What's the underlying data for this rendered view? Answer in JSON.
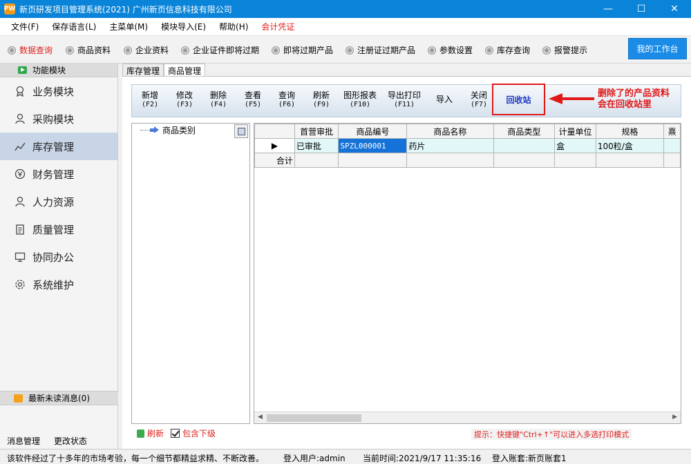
{
  "window": {
    "title": "新页研发项目管理系统(2021) 广州新页信息科技有限公司",
    "icon_text": "PW",
    "controls": [
      "—",
      "☐",
      "✕"
    ]
  },
  "menu": [
    "文件(F)",
    "保存语言(L)",
    "主菜单(M)",
    "模块导入(E)",
    "帮助(H)",
    "会计凭证"
  ],
  "quickbar": {
    "items": [
      "数据查询",
      "商品资料",
      "企业资料",
      "企业证件即将过期",
      "即将过期产品",
      "注册证过期产品",
      "参数设置",
      "库存查询",
      "报警提示"
    ],
    "workbench": "我的工作台"
  },
  "sidebar": {
    "header": "功能模块",
    "items": [
      "业务模块",
      "采购模块",
      "库存管理",
      "财务管理",
      "人力资源",
      "质量管理",
      "协同办公",
      "系统维护"
    ],
    "messages": "最新未读消息(0)",
    "footer": [
      "消息管理",
      "更改状态"
    ]
  },
  "tabs": [
    "库存管理",
    "商品管理"
  ],
  "toolbar": {
    "buttons": [
      {
        "label": "新增",
        "key": "(F2)"
      },
      {
        "label": "修改",
        "key": "(F3)"
      },
      {
        "label": "删除",
        "key": "(F4)"
      },
      {
        "label": "查看",
        "key": "(F5)"
      },
      {
        "label": "查询",
        "key": "(F6)"
      },
      {
        "label": "刷新",
        "key": "(F9)"
      },
      {
        "label": "图形报表",
        "key": "(F10)"
      },
      {
        "label": "导出打印",
        "key": "(F11)"
      },
      {
        "label": "导入",
        "key": ""
      },
      {
        "label": "关闭",
        "key": "(F7)"
      }
    ],
    "recycle": "回收站"
  },
  "annotation": {
    "line1": "删除了的产品资料",
    "line2": "会在回收站里"
  },
  "tree": {
    "root": "商品类别"
  },
  "grid": {
    "headers": [
      "",
      "首营审批",
      "商品编号",
      "商品名称",
      "商品类型",
      "计量单位",
      "规格",
      "熹"
    ],
    "row": {
      "indicator": "▶",
      "cells": [
        "已审批",
        "SPZL000001",
        "药片",
        "",
        "盒",
        "100粒/盒",
        ""
      ]
    },
    "total_label": "合计"
  },
  "bottom": {
    "refresh": "刷新",
    "include_sub": "包含下级",
    "hint": "提示：快捷键\"Ctrl+↑\"可以进入多选打印模式"
  },
  "status": {
    "slogan": "该软件经过了十多年的市场考验，每一个细节都精益求精、不断改善。",
    "user": "登入用户:admin",
    "time": "当前时间:2021/9/17 11:35:16",
    "account": "登入账套:新页账套1"
  }
}
